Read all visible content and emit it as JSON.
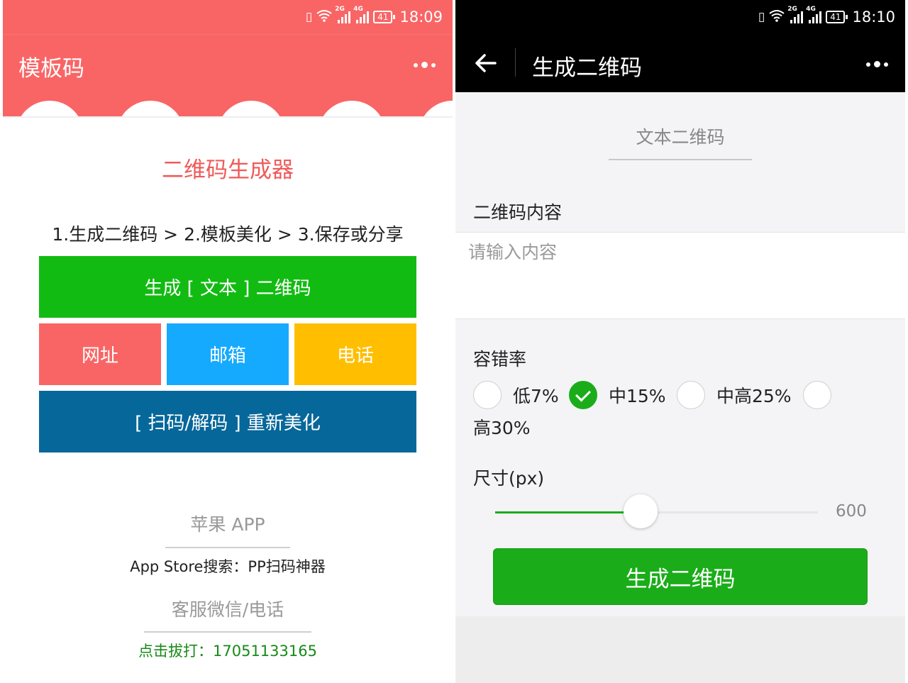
{
  "left": {
    "status": {
      "time": "18:09",
      "battery": "41",
      "net1": "2G",
      "net2": "4G"
    },
    "title": "模板码",
    "brand": "二维码生成器",
    "steps": "1.生成二维码 > 2.模板美化 > 3.保存或分享",
    "buttons": {
      "text_qr": "生成 [ 文本 ] 二维码",
      "url": "网址",
      "email": "邮箱",
      "phone": "电话",
      "rebeautify": "[ 扫码/解码 ] 重新美化"
    },
    "colors": {
      "header": "#f96565",
      "green": "#12bb12",
      "red": "#f96565",
      "blue": "#16aaff",
      "orange": "#ffbe00",
      "navy": "#06679a"
    },
    "footer": {
      "app_heading": "苹果 APP",
      "app_store": "App Store搜索：PP扫码神器",
      "service_heading": "客服微信/电话",
      "call": "点击拔打：17051133165"
    }
  },
  "right": {
    "status": {
      "time": "18:10",
      "battery": "41",
      "net1": "2G",
      "net2": "4G"
    },
    "title": "生成二维码",
    "tab": "文本二维码",
    "content_label": "二维码内容",
    "content_placeholder": "请输入内容",
    "error_label": "容错率",
    "error_options": [
      "低7%",
      "中15%",
      "中高25%",
      "高30%"
    ],
    "error_selected": 1,
    "size_label": "尺寸(px)",
    "size_value": "600",
    "size_fraction": 0.45,
    "generate_button": "生成二维码",
    "accent": "#1aad19"
  }
}
